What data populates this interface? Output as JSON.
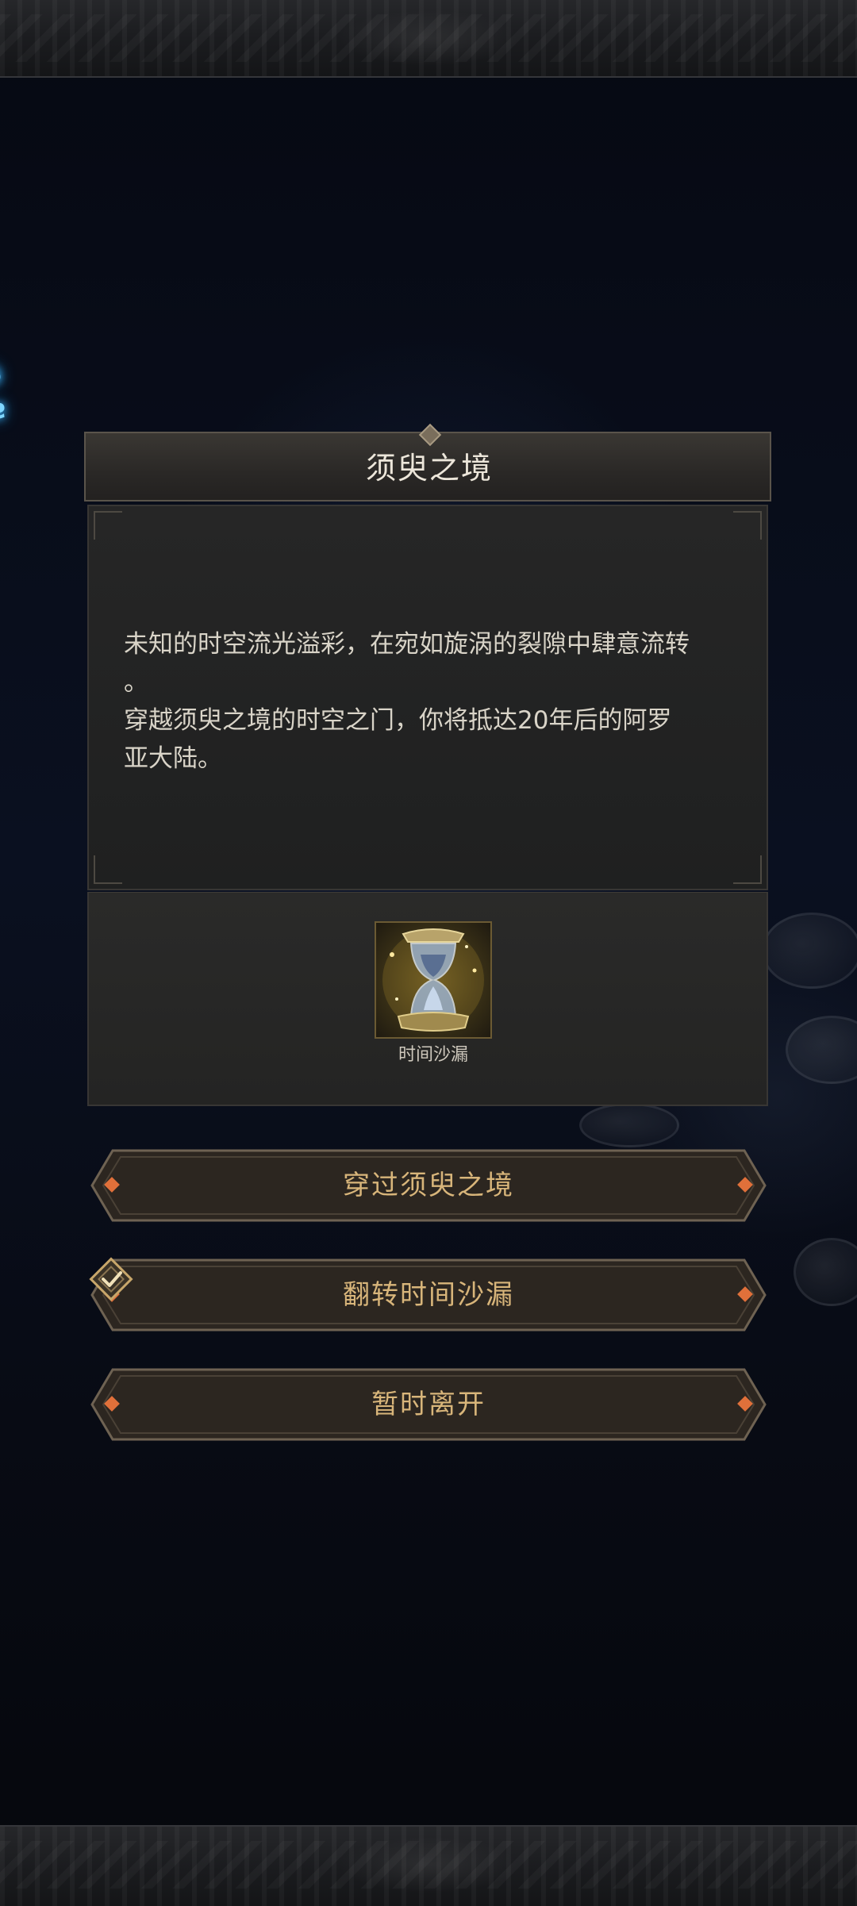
{
  "dialog": {
    "title": "须臾之境",
    "description": "未知的时空流光溢彩，在宛如旋涡的裂隙中肆意流转\n。\n穿越须臾之境的时空之门，你将抵达20年后的阿罗\n亚大陆。",
    "reward_item": {
      "name": "时间沙漏",
      "icon": "hourglass-icon"
    }
  },
  "options": [
    {
      "label": "穿过须臾之境",
      "checked": false
    },
    {
      "label": "翻转时间沙漏",
      "checked": true
    },
    {
      "label": "暂时离开",
      "checked": false
    }
  ],
  "colors": {
    "button_text": "#d8b57a",
    "accent_gem": "#e0703a",
    "rune_glow": "#7fd7ff"
  }
}
